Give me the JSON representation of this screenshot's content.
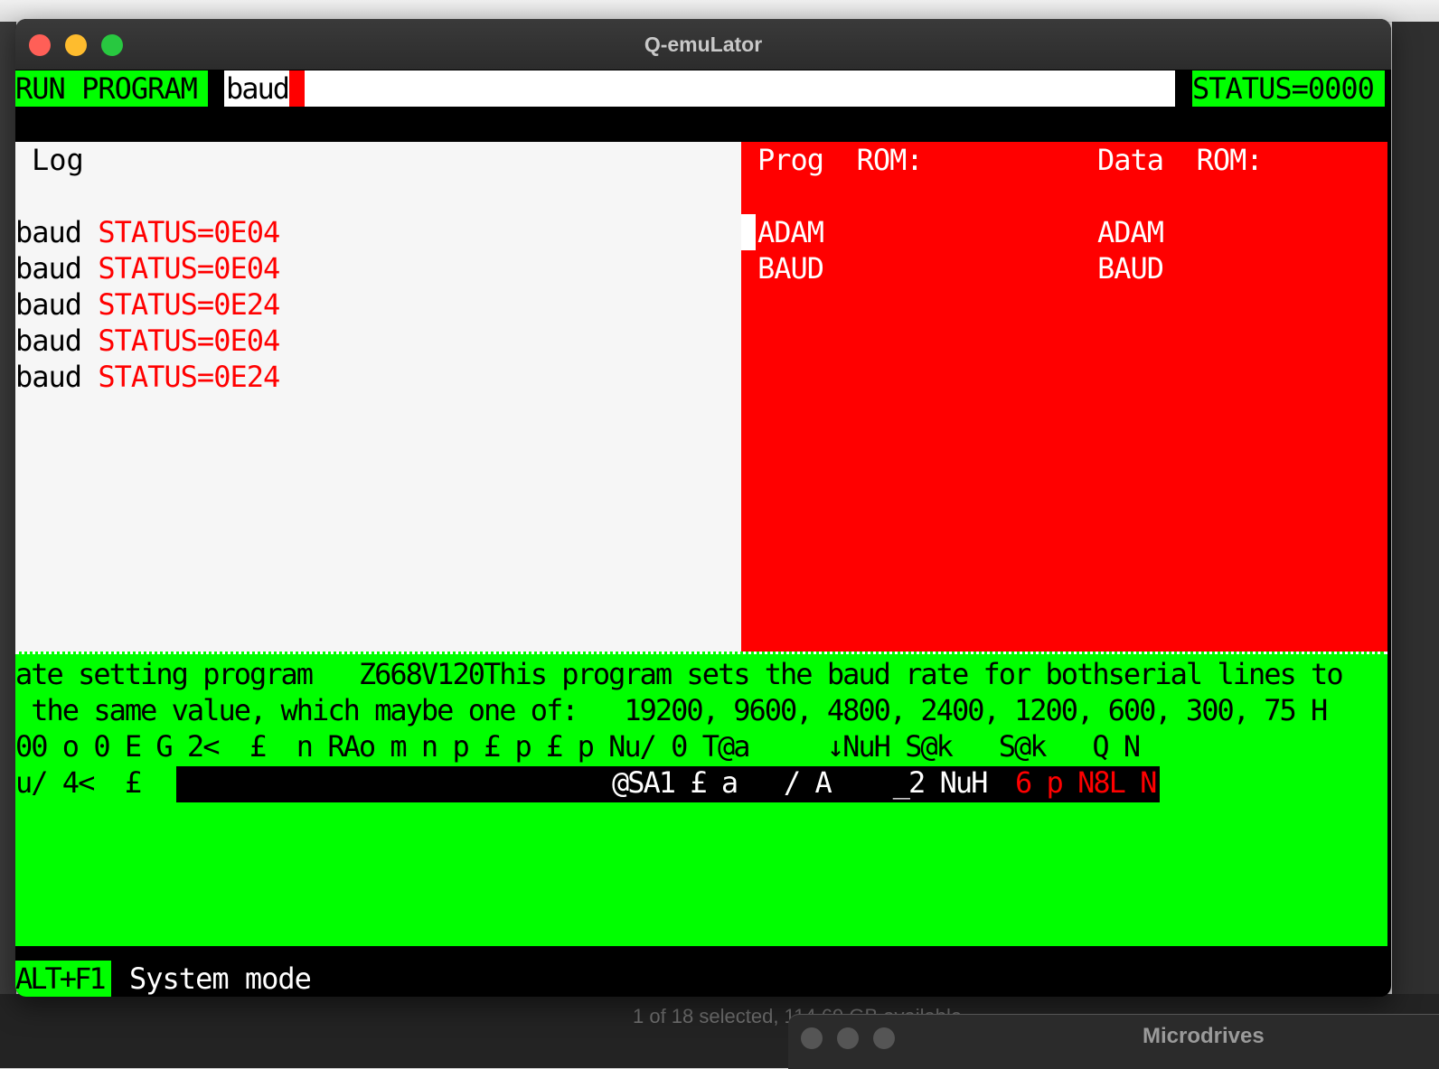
{
  "app": {
    "window_title": "Q-emuLator"
  },
  "command_bar": {
    "mode_label": "RUN PROGRAM",
    "input_value": "baud",
    "status": "STATUS=0000"
  },
  "log": {
    "title": "Log",
    "entries": [
      {
        "command": "baud",
        "status": "STATUS=0E04"
      },
      {
        "command": "baud",
        "status": "STATUS=0E04"
      },
      {
        "command": "baud",
        "status": "STATUS=0E24"
      },
      {
        "command": "baud",
        "status": "STATUS=0E04"
      },
      {
        "command": "baud",
        "status": "STATUS=0E24"
      }
    ]
  },
  "roms": {
    "prog_title": "Prog  ROM:",
    "data_title": "Data  ROM:",
    "prog_items": [
      "ADAM",
      "BAUD"
    ],
    "data_items": [
      "ADAM",
      "BAUD"
    ]
  },
  "dump": {
    "line1": "ate setting program   Z668V120This program sets the baud rate for bothserial lines to",
    "line2": " the same value, which maybe one of:   19200, 9600, 4800, 2400, 1200, 600, 300, 75 H",
    "line3": "00 o 0 E G 2<  £  n RAo m n p £ p £ p Nu/ 0 T@a     ↓NuH S@k   S@k   Q N",
    "line4": "u/ 4<  £",
    "line4_inverse": "@SA1 £ a   / A    _2 NuH",
    "line4_inverse_red": "6 p N8L N"
  },
  "footer": {
    "hotkey": "ALT+F1",
    "mode": "System mode"
  },
  "background": {
    "finder_status": "1 of 18 selected, 114.69 GB available",
    "second_window_title": "Microdrives"
  },
  "colors": {
    "ql_green": "#00ff00",
    "ql_red": "#ff0000",
    "ql_white": "#ffffff",
    "ql_black": "#000000"
  }
}
